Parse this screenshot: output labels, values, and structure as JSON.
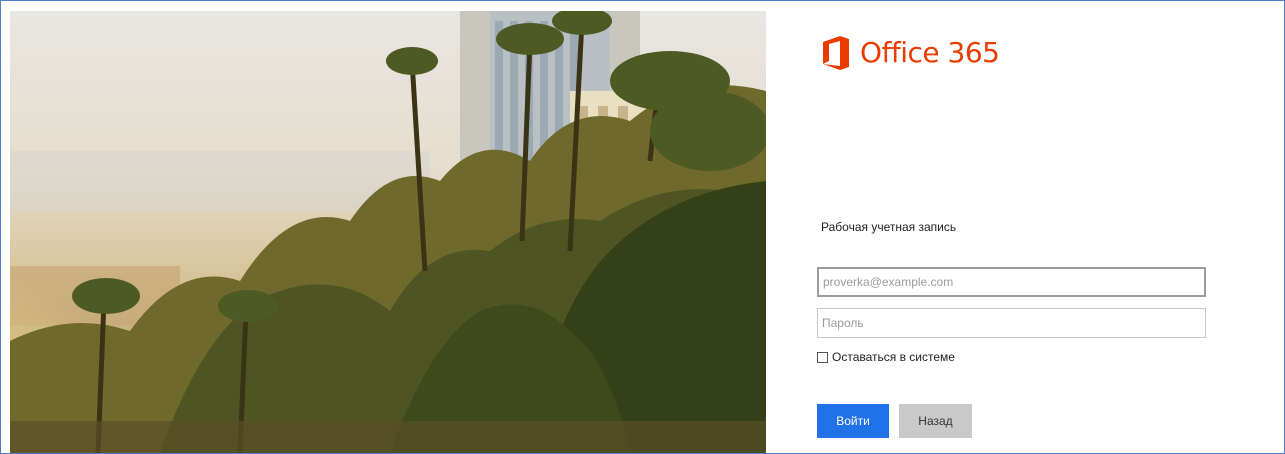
{
  "brand": {
    "name": "Office 365",
    "accent": "#eb3c00",
    "logo_icon": "office-logo-icon"
  },
  "form": {
    "heading": "Рабочая учетная запись",
    "email_placeholder": "proverka@example.com",
    "password_placeholder": "Пароль",
    "remember_label": "Оставаться в системе",
    "remember_checked": false,
    "signin_label": "Войти",
    "back_label": "Назад",
    "signin_color": "#2172e8",
    "back_color": "#c9c9c9"
  },
  "frame_border_color": "#4f7fc4"
}
